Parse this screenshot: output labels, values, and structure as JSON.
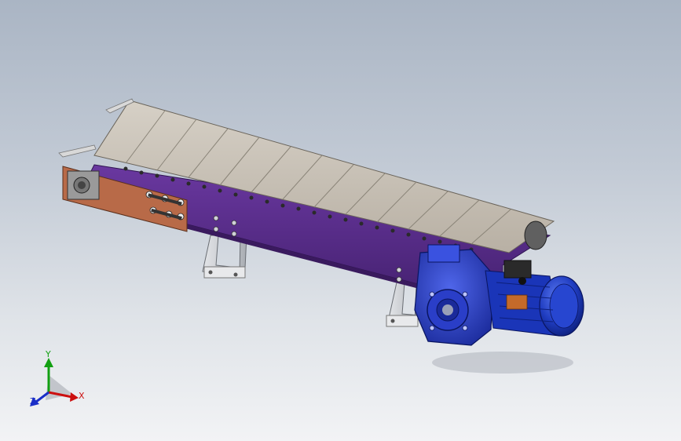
{
  "viewport": {
    "background_top": "#aab5c4",
    "background_bottom": "#f2f3f5"
  },
  "model": {
    "colors": {
      "belt": "#c8c1b6",
      "frame": "#5a2d8c",
      "end_plate": "#b86a48",
      "gearbox": "#2a3ec8",
      "motor": "#1f3cc0",
      "supports": "#cfd2d6"
    },
    "motor_nameplate_color": "#c46a2a"
  },
  "triad": {
    "x_label": "X",
    "y_label": "Y",
    "z_label": "Z",
    "x_color": "#cc1010",
    "y_color": "#12a012",
    "z_color": "#1a2fc8"
  }
}
